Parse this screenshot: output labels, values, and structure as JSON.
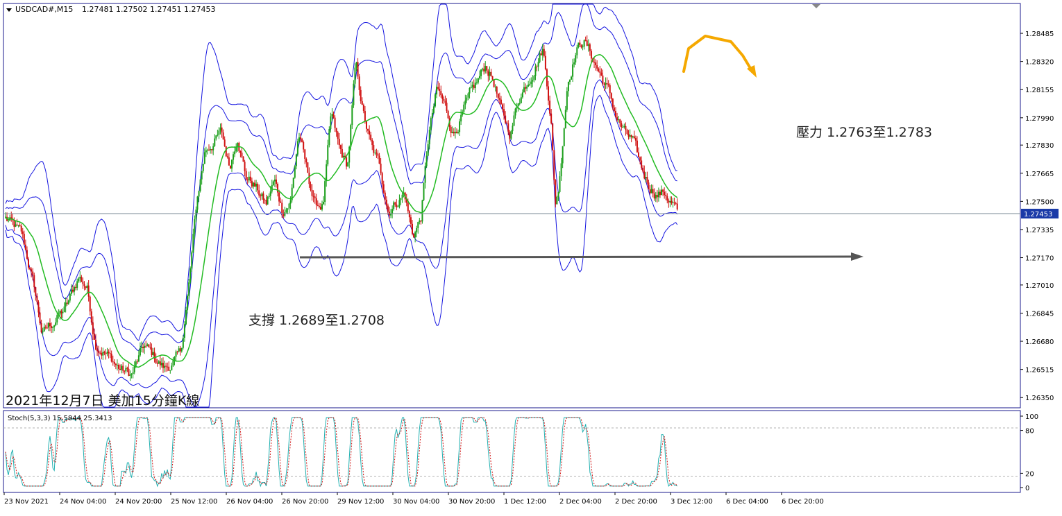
{
  "header": {
    "symbol": "USDCAD#,M15",
    "ohlc": "1.27481 1.27502 1.27451 1.27453"
  },
  "chart_data": {
    "type": "candlestick",
    "symbol": "USDCAD#",
    "timeframe": "M15",
    "title": "2021年12月7日 美加15分鐘K線",
    "current_price": 1.27453,
    "current_price_label": "1.27453",
    "y_ticks": [
      "1.28485",
      "1.28320",
      "1.28155",
      "1.27990",
      "1.27830",
      "1.27665",
      "1.27500",
      "1.27335",
      "1.27170",
      "1.27010",
      "1.26845",
      "1.26680",
      "1.26515",
      "1.26350"
    ],
    "x_ticks": [
      "23 Nov 2021",
      "24 Nov 04:00",
      "24 Nov 20:00",
      "25 Nov 12:00",
      "26 Nov 04:00",
      "26 Nov 20:00",
      "29 Nov 12:00",
      "30 Nov 04:00",
      "30 Nov 20:00",
      "1 Dec 12:00",
      "2 Dec 04:00",
      "2 Dec 20:00",
      "3 Dec 12:00",
      "6 Dec 04:00",
      "6 Dec 20:00"
    ],
    "ylim": [
      1.2629,
      1.2866
    ],
    "price_path": [
      [
        0,
        1.274
      ],
      [
        0.02,
        1.273
      ],
      [
        0.035,
        1.27
      ],
      [
        0.045,
        1.2672
      ],
      [
        0.06,
        1.268
      ],
      [
        0.075,
        1.2688
      ],
      [
        0.09,
        1.2706
      ],
      [
        0.1,
        1.27
      ],
      [
        0.11,
        1.2668
      ],
      [
        0.125,
        1.266
      ],
      [
        0.14,
        1.2652
      ],
      [
        0.155,
        1.2648
      ],
      [
        0.17,
        1.2665
      ],
      [
        0.18,
        1.266
      ],
      [
        0.195,
        1.2652
      ],
      [
        0.205,
        1.2655
      ],
      [
        0.215,
        1.266
      ],
      [
        0.225,
        1.27
      ],
      [
        0.235,
        1.275
      ],
      [
        0.245,
        1.278
      ],
      [
        0.255,
        1.2785
      ],
      [
        0.265,
        1.279
      ],
      [
        0.275,
        1.277
      ],
      [
        0.285,
        1.279
      ],
      [
        0.295,
        1.2765
      ],
      [
        0.305,
        1.276
      ],
      [
        0.32,
        1.2748
      ],
      [
        0.33,
        1.2762
      ],
      [
        0.34,
        1.2745
      ],
      [
        0.35,
        1.275
      ],
      [
        0.36,
        1.279
      ],
      [
        0.37,
        1.2768
      ],
      [
        0.38,
        1.2748
      ],
      [
        0.39,
        1.2748
      ],
      [
        0.4,
        1.28
      ],
      [
        0.41,
        1.278
      ],
      [
        0.42,
        1.277
      ],
      [
        0.43,
        1.283
      ],
      [
        0.44,
        1.28
      ],
      [
        0.45,
        1.278
      ],
      [
        0.46,
        1.277
      ],
      [
        0.47,
        1.2745
      ],
      [
        0.48,
        1.275
      ],
      [
        0.49,
        1.2755
      ],
      [
        0.5,
        1.273
      ],
      [
        0.51,
        1.274
      ],
      [
        0.52,
        1.279
      ],
      [
        0.53,
        1.2815
      ],
      [
        0.54,
        1.2805
      ],
      [
        0.55,
        1.279
      ],
      [
        0.56,
        1.28
      ],
      [
        0.57,
        1.281
      ],
      [
        0.58,
        1.282
      ],
      [
        0.59,
        1.283
      ],
      [
        0.6,
        1.282
      ],
      [
        0.61,
        1.28
      ],
      [
        0.62,
        1.279
      ],
      [
        0.63,
        1.281
      ],
      [
        0.64,
        1.282
      ],
      [
        0.65,
        1.283
      ],
      [
        0.66,
        1.284
      ],
      [
        0.67,
        1.28
      ],
      [
        0.675,
        1.2748
      ],
      [
        0.68,
        1.276
      ],
      [
        0.69,
        1.282
      ],
      [
        0.7,
        1.2838
      ],
      [
        0.71,
        1.2845
      ],
      [
        0.72,
        1.2835
      ],
      [
        0.73,
        1.2825
      ],
      [
        0.74,
        1.2815
      ],
      [
        0.75,
        1.28
      ],
      [
        0.76,
        1.279
      ],
      [
        0.77,
        1.2785
      ],
      [
        0.78,
        1.277
      ],
      [
        0.79,
        1.276
      ],
      [
        0.8,
        1.2755
      ],
      [
        0.81,
        1.2755
      ],
      [
        0.82,
        1.2748
      ],
      [
        0.825,
        1.27453
      ]
    ],
    "support": {
      "label": "支撐 1.2689至1.2708",
      "price": 1.2719
    },
    "resistance": {
      "label": "壓力 1.2763至1.2783"
    },
    "indicator": {
      "label": "Stoch(5,3,3) 15.5844 25.3413",
      "y_ticks": [
        "100",
        "80",
        "20",
        "0"
      ],
      "levels": [
        80,
        20
      ]
    },
    "colors": {
      "background": "#ffffff",
      "border": "#1a1a8c",
      "bands": "#1515e0",
      "candle_up": "#1a9e1a",
      "candle_down": "#d01010",
      "ma": "#22bb22",
      "arrow_support": "#555555",
      "arrow_top": "#f5a800",
      "price_label_bg": "#1a3aa8",
      "stoch_main": "#20b0b0",
      "stoch_signal": "#d01010",
      "level_line": "#b0b0b0"
    }
  }
}
